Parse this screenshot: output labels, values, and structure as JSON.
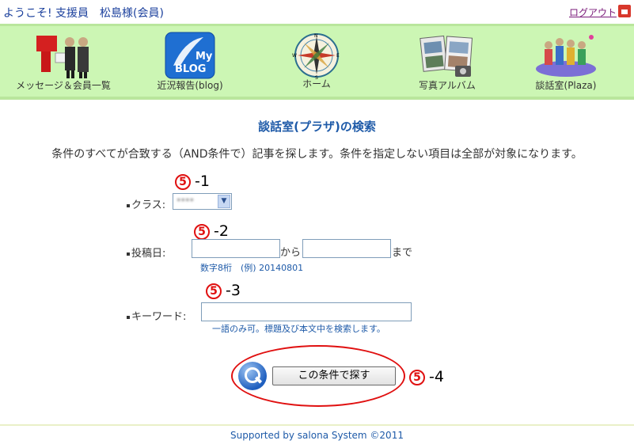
{
  "header": {
    "welcome": "ようこそ! 支援員　松島様(会員)",
    "logout_label": "ログアウト"
  },
  "nav": {
    "items": [
      {
        "label": "メッセージ＆会員一覧",
        "icon": "message-members-icon"
      },
      {
        "label": "近況報告(blog)",
        "icon": "my-blog-icon",
        "icon_text": "My\nBLOG"
      },
      {
        "label": "ホーム",
        "icon": "compass-home-icon",
        "compass": [
          "N",
          "E",
          "S",
          "W"
        ]
      },
      {
        "label": "写真アルバム",
        "icon": "photo-album-icon"
      },
      {
        "label": "談話室(Plaza)",
        "icon": "plaza-people-icon"
      }
    ]
  },
  "page": {
    "title": "談話室(プラザ)の検索",
    "description": "条件のすべてが合致する（AND条件で）記事を探します。条件を指定しない項目は全部が対象になります。"
  },
  "form": {
    "class_label": "クラス:",
    "class_value": "****",
    "posted_label": "投稿日:",
    "from_label": "から",
    "until_label": "まで",
    "date_from_value": "",
    "date_to_value": "",
    "date_hint": "数字8桁　(例) 20140801",
    "keyword_label": "キーワード:",
    "keyword_value": "",
    "keyword_hint": "一語のみ可。標題及び本文中を検索します。",
    "search_button": "この条件で探す"
  },
  "annotations": {
    "circle": "5",
    "a1": "-1",
    "a2": "-2",
    "a3": "-3",
    "a4": "-4"
  },
  "footer": {
    "text": "Supported by salona System ©2011"
  },
  "colors": {
    "nav_bg": "#ccf6b4",
    "link_blue": "#1e5aa8",
    "annotation_red": "#e01010"
  }
}
